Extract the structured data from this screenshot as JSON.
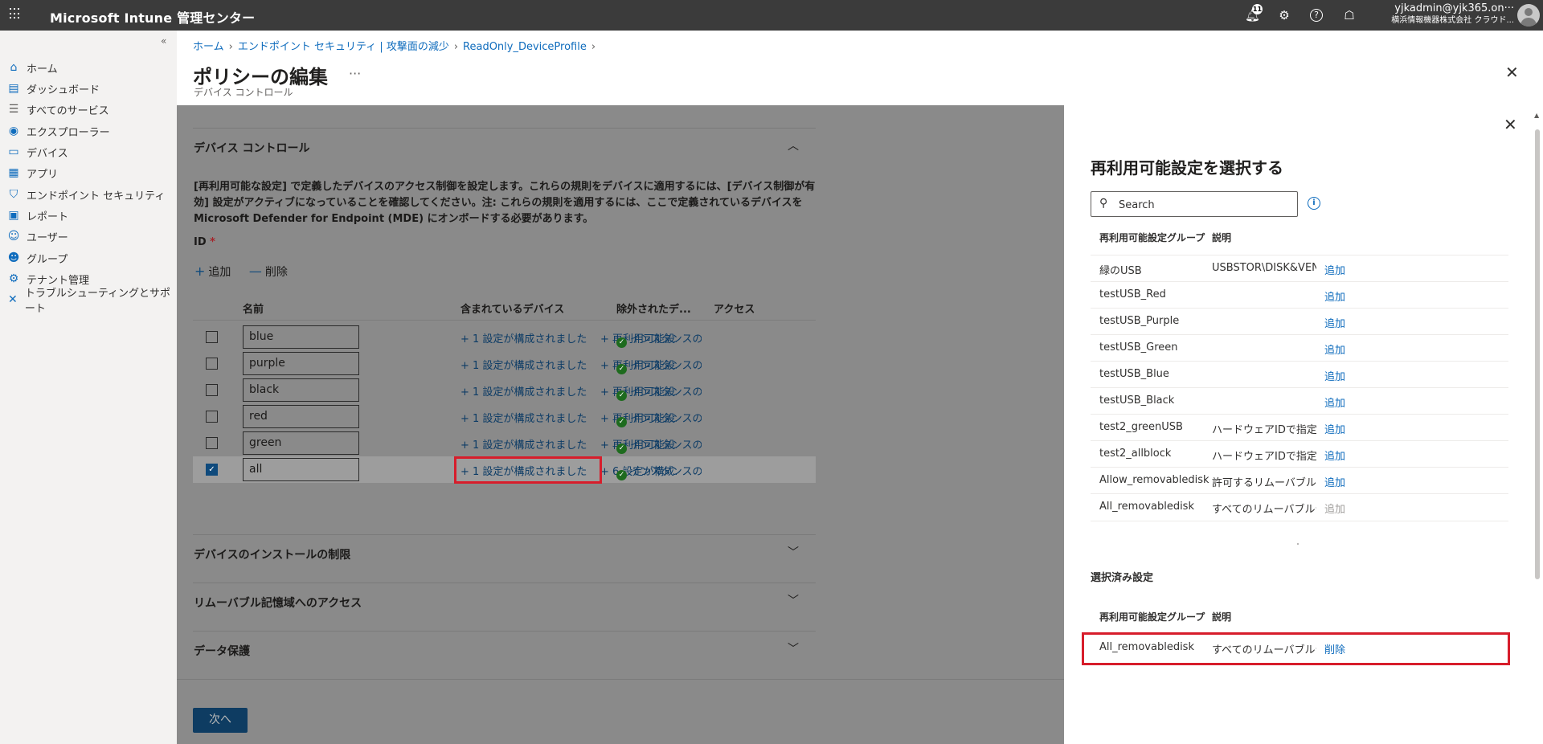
{
  "app": {
    "title": "Microsoft Intune 管理センター",
    "notification_count": "11",
    "user_name": "yjkadmin@yjk365.on···",
    "user_org": "横浜情報機器株式会社 クラウド..."
  },
  "sidebar": {
    "collapse": "«",
    "items": [
      {
        "label": "ホーム",
        "icon": "home-icon"
      },
      {
        "label": "ダッシュボード",
        "icon": "dashboard-icon"
      },
      {
        "label": "すべてのサービス",
        "icon": "list-icon"
      },
      {
        "label": "エクスプローラー",
        "icon": "explorer-icon"
      },
      {
        "label": "デバイス",
        "icon": "device-icon"
      },
      {
        "label": "アプリ",
        "icon": "apps-icon"
      },
      {
        "label": "エンドポイント セキュリティ",
        "icon": "shield-icon"
      },
      {
        "label": "レポート",
        "icon": "report-icon"
      },
      {
        "label": "ユーザー",
        "icon": "user-icon"
      },
      {
        "label": "グループ",
        "icon": "group-icon"
      },
      {
        "label": "テナント管理",
        "icon": "tenant-icon"
      },
      {
        "label": "トラブルシューティングとサポート",
        "icon": "wrench-icon"
      }
    ]
  },
  "breadcrumb": [
    "ホーム",
    "エンドポイント セキュリティ | 攻撃面の減少",
    "ReadOnly_DeviceProfile"
  ],
  "page": {
    "title": "ポリシーの編集",
    "subtitle": "デバイス コントロール",
    "more": "···",
    "close": "✕"
  },
  "device_control": {
    "title": "デバイス コントロール",
    "description": "[再利用可能な設定] で定義したデバイスのアクセス制御を設定します。これらの規則をデバイスに適用するには、[デバイス制御が有効] 設定がアクティブになっていることを確認してください。注: これらの規則を適用するには、ここで定義されているデバイスをMicrosoft Defender for Endpoint (MDE) にオンボードする必要があります。",
    "id_label": "ID",
    "required": "*",
    "add": "追加",
    "delete": "削除",
    "columns": [
      "名前",
      "含まれているデバイス",
      "除外されたデ...",
      "アクセス"
    ],
    "rows": [
      {
        "name": "blue",
        "included": "+ 1 設定が構成されました",
        "excluded": "+ 再利用可能設...",
        "access": "インスタンスの",
        "checked": false
      },
      {
        "name": "purple",
        "included": "+ 1 設定が構成されました",
        "excluded": "+ 再利用可能設...",
        "access": "インスタンスの",
        "checked": false
      },
      {
        "name": "black",
        "included": "+ 1 設定が構成されました",
        "excluded": "+ 再利用可能設...",
        "access": "インスタンスの",
        "checked": false
      },
      {
        "name": "red",
        "included": "+ 1 設定が構成されました",
        "excluded": "+ 再利用可能設...",
        "access": "インスタンスの",
        "checked": false
      },
      {
        "name": "green",
        "included": "+ 1 設定が構成されました",
        "excluded": "+ 再利用可能設...",
        "access": "インスタンスの",
        "checked": false
      },
      {
        "name": "all",
        "included": "+ 1 設定が構成されました",
        "excluded": "+ 6 設定が構成...",
        "access": "インスタンスの",
        "checked": true
      }
    ]
  },
  "sections": [
    "デバイスのインストールの制限",
    "リムーバブル記憶域へのアクセス",
    "データ保護"
  ],
  "next_button": "次へ",
  "panel": {
    "title": "再利用可能設定を選択する",
    "search_placeholder": "Search",
    "col_group": "再利用可能設定グループ",
    "col_desc": "説明",
    "items": [
      {
        "group": "緑のUSB",
        "desc": "USBSTOR\\DISK&VEN_VEN",
        "action": "追加",
        "disabled": false
      },
      {
        "group": "testUSB_Red",
        "desc": "",
        "action": "追加",
        "disabled": false
      },
      {
        "group": "testUSB_Purple",
        "desc": "",
        "action": "追加",
        "disabled": false
      },
      {
        "group": "testUSB_Green",
        "desc": "",
        "action": "追加",
        "disabled": false
      },
      {
        "group": "testUSB_Blue",
        "desc": "",
        "action": "追加",
        "disabled": false
      },
      {
        "group": "testUSB_Black",
        "desc": "",
        "action": "追加",
        "disabled": false
      },
      {
        "group": "test2_greenUSB",
        "desc": "ハードウェアIDで指定",
        "action": "追加",
        "disabled": false
      },
      {
        "group": "test2_allblock",
        "desc": "ハードウェアIDで指定",
        "action": "追加",
        "disabled": false
      },
      {
        "group": "Allow_removabledisk",
        "desc": "許可するリムーバブルディスク",
        "action": "追加",
        "disabled": false
      },
      {
        "group": "All_removabledisk",
        "desc": "すべてのリムーバブルディスク",
        "action": "追加",
        "disabled": true
      }
    ],
    "selected_title": "選択済み設定",
    "selected_col_group": "再利用可能設定グループ",
    "selected_col_desc": "説明",
    "selected": [
      {
        "group": "All_removabledisk",
        "desc": "すべてのリムーバブルディスク",
        "action": "削除"
      }
    ]
  },
  "colors": {
    "accent": "#0f6cbd",
    "highlight": "#d71d2b",
    "topbar": "#3b3b3b"
  }
}
